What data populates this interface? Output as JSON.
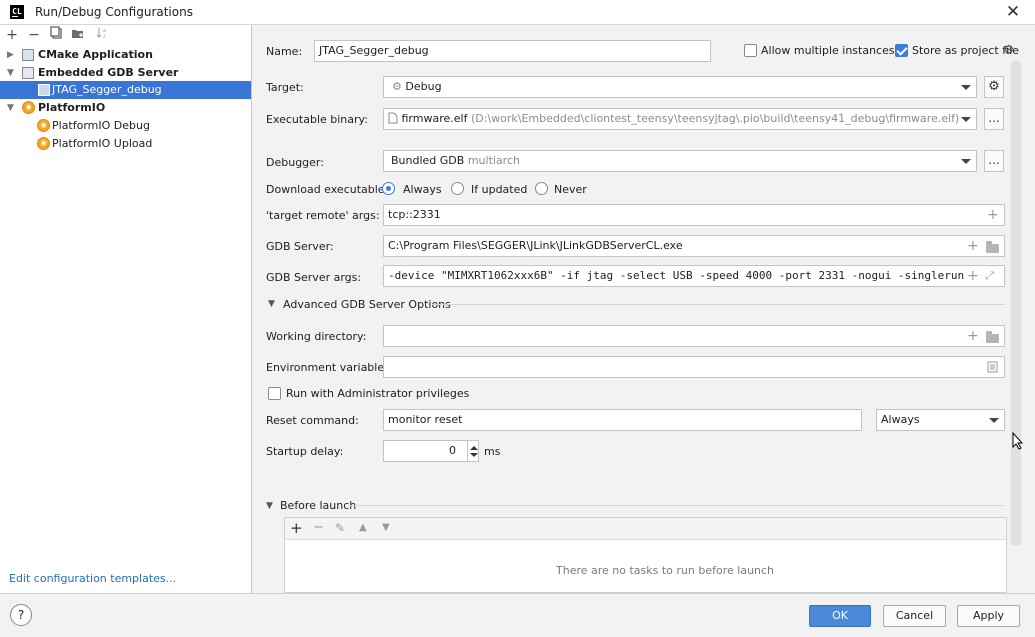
{
  "window": {
    "title": "Run/Debug Configurations",
    "app_icon_text": "CL"
  },
  "left_toolbar": {
    "add": "+",
    "remove": "−",
    "copy": "⧉",
    "folder": "▇",
    "sort": "↓"
  },
  "tree": [
    {
      "label": "CMake Application",
      "type": "group"
    },
    {
      "label": "Embedded GDB Server",
      "type": "group"
    },
    {
      "label": "JTAG_Segger_debug",
      "type": "item"
    },
    {
      "label": "PlatformIO",
      "type": "group"
    },
    {
      "label": "PlatformIO Debug",
      "type": "item"
    },
    {
      "label": "PlatformIO Upload",
      "type": "item"
    }
  ],
  "edit_templates_link": "Edit configuration templates...",
  "form": {
    "name_label": "Name:",
    "name_value": "JTAG_Segger_debug",
    "allow_multiple_label": "Allow multiple instances",
    "allow_multiple_checked": false,
    "store_project_label": "Store as project file",
    "store_project_checked": true,
    "target_label": "Target:",
    "target_value": "Debug",
    "exe_label": "Executable binary:",
    "exe_name": "firmware.elf",
    "exe_path": "(D:\\work\\Embedded\\cliontest_teensy\\teensyjtag\\.pio\\build\\teensy41_debug\\firmware.elf)",
    "debugger_label": "Debugger:",
    "debugger_value": "Bundled GDB",
    "debugger_suffix": "multiarch",
    "download_label": "Download executable:",
    "download_options": [
      "Always",
      "If updated",
      "Never"
    ],
    "download_selected": "Always",
    "target_remote_label": "'target remote' args:",
    "target_remote_value": "tcp::2331",
    "gdb_server_label": "GDB Server:",
    "gdb_server_value": "C:\\Program Files\\SEGGER\\JLink\\JLinkGDBServerCL.exe",
    "gdb_server_args_label": "GDB Server args:",
    "gdb_server_args_value": "-device \"MIMXRT1062xxx6B\" -if jtag -select USB -speed 4000 -port 2331 -nogui -singlerun",
    "advanced_label": "Advanced GDB Server Options",
    "working_dir_label": "Working directory:",
    "working_dir_value": "",
    "env_label": "Environment variables:",
    "env_value": "",
    "admin_label": "Run with Administrator privileges",
    "admin_checked": false,
    "reset_label": "Reset command:",
    "reset_value": "monitor reset",
    "reset_when": "Always",
    "startup_label": "Startup delay:",
    "startup_value": "0",
    "startup_unit": "ms",
    "before_launch_label": "Before launch",
    "no_tasks_text": "There are no tasks to run before launch"
  },
  "buttons": {
    "ok": "OK",
    "cancel": "Cancel",
    "apply": "Apply",
    "help": "?"
  },
  "colors": {
    "selection": "#3875d6",
    "primary_button": "#4a8ad8",
    "link": "#2470b3",
    "platformio": "#f5a623"
  }
}
